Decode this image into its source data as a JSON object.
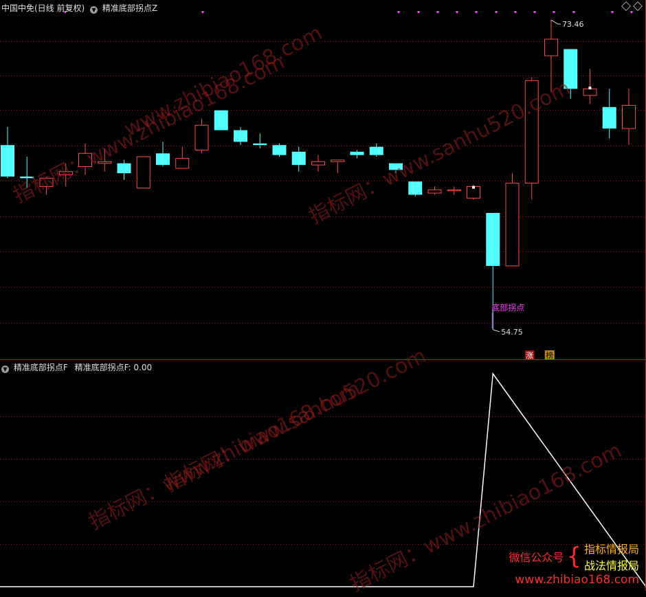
{
  "main_header": {
    "stock_label": "中国中免(日线 前复权)",
    "indicator_label": "精准底部拐点Z"
  },
  "sub_header": {
    "indicator_name": "精准底部拐点F",
    "indicator_value": "精准底部拐点F: 0.00"
  },
  "watermarks": [
    "www.zhibiao168.com",
    "指标网：www.zhibiao168.com",
    "指标网：www.sanhu520.com",
    "指标网：www.sanhu520.com",
    "指标网：www.zhibiao168.com",
    "指标网：www.zhibiao168.com"
  ],
  "promo": {
    "left": "微信公众号",
    "right_line1": "指标情报局",
    "right_line2": "战法情报局",
    "url": "www.zhibiao168.com"
  },
  "colors": {
    "up": "#ff4b4b",
    "down": "#54ffff",
    "grid": "#8a1010",
    "magenta": "#ff3cff",
    "line": "#ffffff",
    "promo_red": "#ff2020",
    "promo_yellow": "#ffff40"
  },
  "chart_data": [
    {
      "type": "candlestick",
      "title": "中国中免(日线 前复权)",
      "ylim": [
        53,
        74.5
      ],
      "max_label": "73.46",
      "min_label": "54.75",
      "signal_label": "底部拐点",
      "signal_index": 25,
      "badges": [
        "涨",
        "榜"
      ],
      "candles": [
        {
          "o": 65.9,
          "h": 67.0,
          "l": 63.9,
          "c": 64.0
        },
        {
          "o": 64.0,
          "h": 65.2,
          "l": 63.3,
          "c": 63.9
        },
        {
          "o": 63.4,
          "h": 64.0,
          "l": 62.9,
          "c": 63.9
        },
        {
          "o": 64.1,
          "h": 64.8,
          "l": 63.4,
          "c": 64.3
        },
        {
          "o": 64.6,
          "h": 66.0,
          "l": 64.1,
          "c": 65.4
        },
        {
          "o": 64.8,
          "h": 65.7,
          "l": 64.3,
          "c": 64.9
        },
        {
          "o": 64.8,
          "h": 65.0,
          "l": 63.8,
          "c": 64.2
        },
        {
          "o": 63.3,
          "h": 65.2,
          "l": 63.3,
          "c": 65.2
        },
        {
          "o": 65.4,
          "h": 66.1,
          "l": 64.6,
          "c": 64.7
        },
        {
          "o": 64.5,
          "h": 65.8,
          "l": 64.5,
          "c": 65.1
        },
        {
          "o": 65.6,
          "h": 67.5,
          "l": 65.4,
          "c": 67.1
        },
        {
          "o": 68.0,
          "h": 68.0,
          "l": 66.8,
          "c": 66.8
        },
        {
          "o": 66.8,
          "h": 67.0,
          "l": 65.9,
          "c": 66.1
        },
        {
          "o": 66.0,
          "h": 66.6,
          "l": 65.7,
          "c": 65.9
        },
        {
          "o": 65.9,
          "h": 66.0,
          "l": 65.2,
          "c": 65.3
        },
        {
          "o": 65.5,
          "h": 65.8,
          "l": 64.3,
          "c": 64.7
        },
        {
          "o": 64.7,
          "h": 65.3,
          "l": 64.3,
          "c": 64.9
        },
        {
          "o": 64.9,
          "h": 65.0,
          "l": 64.2,
          "c": 65.0
        },
        {
          "o": 65.5,
          "h": 65.6,
          "l": 65.1,
          "c": 65.3
        },
        {
          "o": 65.8,
          "h": 66.0,
          "l": 65.2,
          "c": 65.3
        },
        {
          "o": 64.8,
          "h": 64.8,
          "l": 64.2,
          "c": 64.4
        },
        {
          "o": 63.7,
          "h": 63.7,
          "l": 62.8,
          "c": 62.9
        },
        {
          "o": 63.0,
          "h": 63.4,
          "l": 62.9,
          "c": 63.2
        },
        {
          "o": 63.2,
          "h": 63.4,
          "l": 62.9,
          "c": 63.2
        },
        {
          "o": 62.7,
          "h": 63.5,
          "l": 62.6,
          "c": 63.4
        },
        {
          "o": 61.8,
          "h": 61.8,
          "l": 54.75,
          "c": 58.6
        },
        {
          "o": 58.6,
          "h": 64.2,
          "l": 58.6,
          "c": 63.6
        },
        {
          "o": 63.6,
          "h": 70.0,
          "l": 62.6,
          "c": 69.8
        },
        {
          "o": 71.3,
          "h": 73.46,
          "l": 69.1,
          "c": 72.3
        },
        {
          "o": 71.7,
          "h": 71.7,
          "l": 68.7,
          "c": 69.3
        },
        {
          "o": 68.9,
          "h": 70.5,
          "l": 68.4,
          "c": 69.3
        },
        {
          "o": 68.2,
          "h": 69.3,
          "l": 66.3,
          "c": 66.9
        },
        {
          "o": 66.9,
          "h": 69.3,
          "l": 65.9,
          "c": 68.3
        }
      ]
    },
    {
      "type": "line",
      "title": "精准底部拐点F",
      "ylim": [
        0,
        1
      ],
      "series": [
        {
          "values": [
            0,
            0,
            0,
            0,
            0,
            0,
            0,
            0,
            0,
            0,
            0,
            0,
            0,
            0,
            0,
            0,
            0,
            0,
            0,
            0,
            0,
            0,
            0,
            0,
            0,
            1,
            0
          ]
        }
      ]
    }
  ]
}
